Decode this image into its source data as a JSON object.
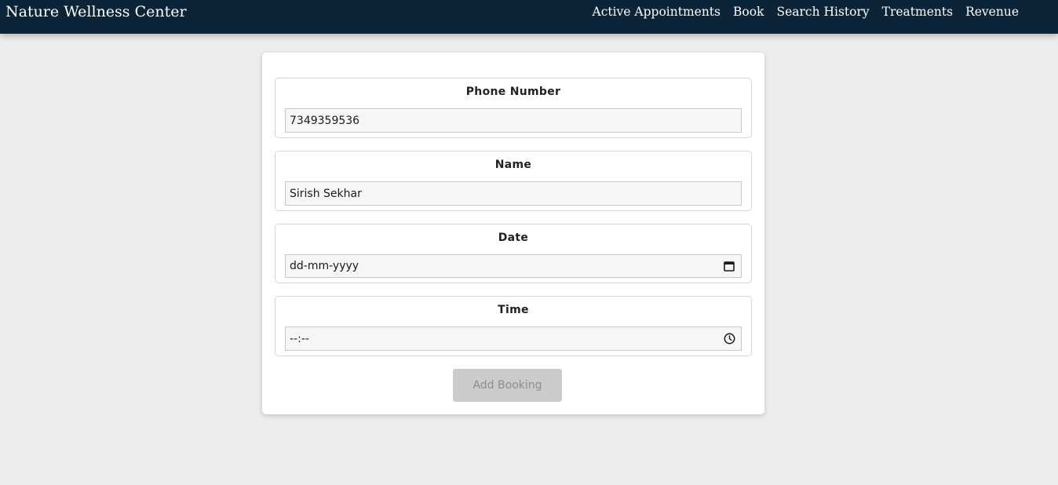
{
  "header": {
    "brand": "Nature Wellness Center",
    "nav": [
      "Active Appointments",
      "Book",
      "Search History",
      "Treatments",
      "Revenue"
    ]
  },
  "form": {
    "phone": {
      "label": "Phone Number",
      "value": "7349359536"
    },
    "name": {
      "label": "Name",
      "value": "Sirish Sekhar"
    },
    "date": {
      "label": "Date",
      "value": "dd-mm-yyyy",
      "icon": "calendar-icon"
    },
    "time": {
      "label": "Time",
      "value": "--:--",
      "icon": "clock-icon"
    },
    "submit_label": "Add Booking",
    "submit_disabled": true
  },
  "colors": {
    "navbar": "#0b2437",
    "page_background": "#ededed",
    "button_disabled": "#cbcbcb"
  }
}
